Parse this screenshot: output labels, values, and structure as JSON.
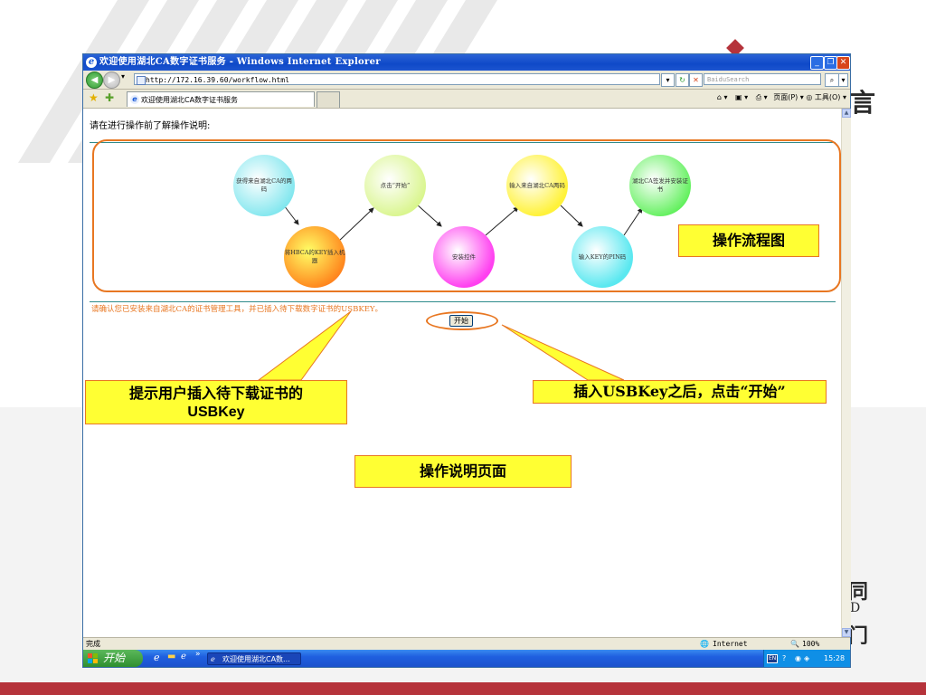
{
  "browser": {
    "window_title": "欢迎使用湖北CA数字证书服务 - Windows Internet Explorer",
    "url": "http://172.16.39.60/workflow.html",
    "search_placeholder": "BaiduSearch",
    "tab_label": "欢迎使用湖北CA数字证书服务",
    "command_bar": "页面(P) ▾ ◎ 工具(O) ▾",
    "status_text": "完成",
    "zone": "Internet",
    "zoom": "100%"
  },
  "page": {
    "instruction": "请在进行操作前了解操作说明:",
    "notice": "请确认您已安装来自湖北CA的证书管理工具，并已插入待下载数字证书的USBKEY。",
    "start_button": "开始"
  },
  "flow": {
    "steps": [
      {
        "text": "获得来自湖北CA的两码",
        "color": "#7fe6ee"
      },
      {
        "text": "将HBCA的KEY插入机器",
        "color": "#ff8a1f"
      },
      {
        "text": "点击“开始”",
        "color": "#d8f58a"
      },
      {
        "text": "安装控件",
        "color": "#ff40f0"
      },
      {
        "text": "输入来自湖北CA两码",
        "color": "#fff23a"
      },
      {
        "text": "输入KEY的PIN码",
        "color": "#5ae8f0"
      },
      {
        "text": "湖北CA签发并安装证书",
        "color": "#5ff05a"
      }
    ]
  },
  "taskbar": {
    "start_label": "开始",
    "task_item": "欢迎使用湖北CA数...",
    "time": "15:28"
  },
  "callouts": {
    "flow_chart": "操作流程图",
    "usbkey_line1": "提示用户插入待下载证书的",
    "usbkey_line2": "USBKey",
    "click_start": "插入USBKey之后，点击“开始”",
    "page_desc": "操作说明页面"
  },
  "colors": {
    "callout_fill": "#ffff33",
    "highlight_orange": "#e87722",
    "bottom_bar": "#b5333b"
  }
}
